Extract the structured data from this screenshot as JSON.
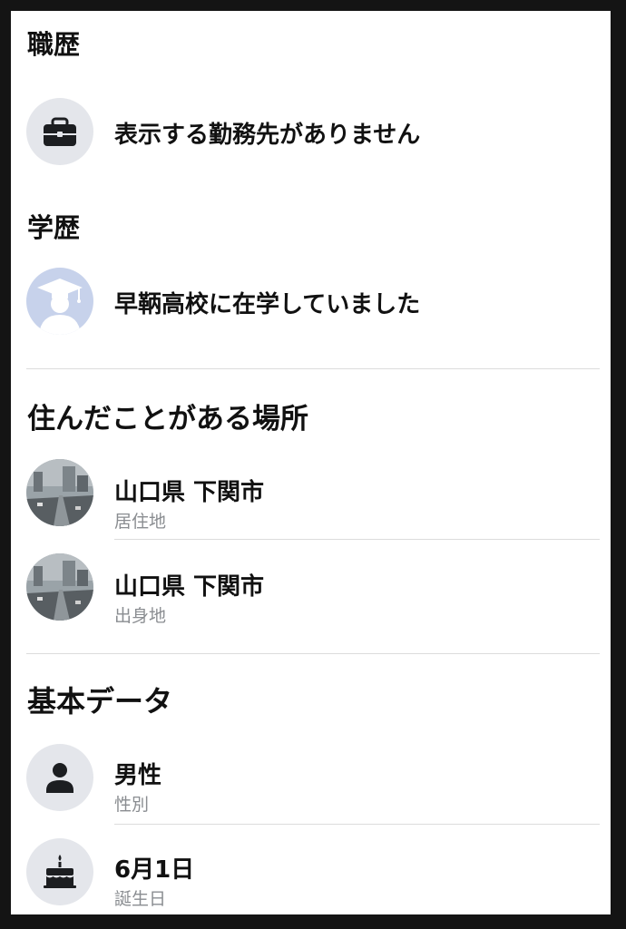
{
  "work": {
    "title": "職歴",
    "empty_text": "表示する勤務先がありません",
    "icon": "briefcase-icon"
  },
  "education": {
    "title": "学歴",
    "item_text": "早鞆高校に在学していました",
    "icon": "graduation-cap-icon"
  },
  "places": {
    "title": "住んだことがある場所",
    "items": [
      {
        "name": "山口県 下関市",
        "type": "居住地"
      },
      {
        "name": "山口県 下関市",
        "type": "出身地"
      }
    ]
  },
  "basic": {
    "title": "基本データ",
    "items": [
      {
        "value": "男性",
        "label": "性別",
        "icon": "person-icon"
      },
      {
        "value": "6月1日",
        "label": "誕生日",
        "icon": "birthday-cake-icon"
      }
    ]
  }
}
